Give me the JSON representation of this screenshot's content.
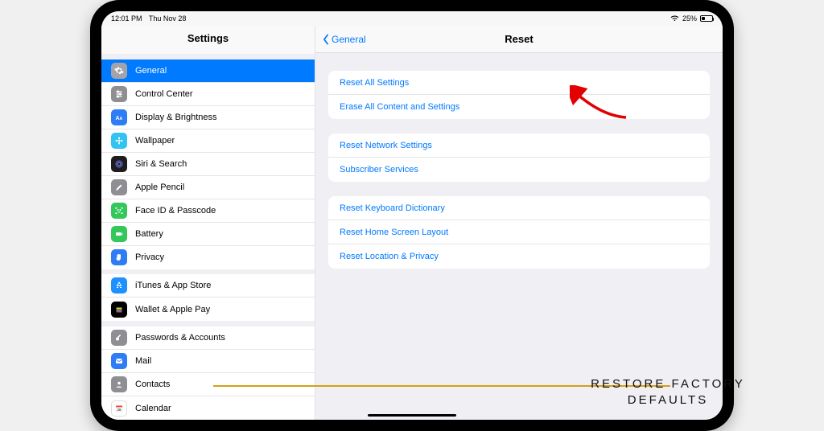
{
  "status": {
    "time": "12:01 PM",
    "date": "Thu Nov 28",
    "battery_pct": "25%"
  },
  "sidebar": {
    "title": "Settings",
    "items": [
      {
        "label": "General",
        "icon": "gear",
        "color": "#8e8e93",
        "selected": true
      },
      {
        "label": "Control Center",
        "icon": "sliders",
        "color": "#8e8e93",
        "selected": false
      },
      {
        "label": "Display & Brightness",
        "icon": "textsize",
        "color": "#2f7df6",
        "selected": false
      },
      {
        "label": "Wallpaper",
        "icon": "flower",
        "color": "#33c3f0",
        "selected": false
      },
      {
        "label": "Siri & Search",
        "icon": "siri",
        "color": "#1d1d1f",
        "selected": false
      },
      {
        "label": "Apple Pencil",
        "icon": "pencil",
        "color": "#8e8e93",
        "selected": false
      },
      {
        "label": "Face ID & Passcode",
        "icon": "faceid",
        "color": "#34c759",
        "selected": false
      },
      {
        "label": "Battery",
        "icon": "battery",
        "color": "#34c759",
        "selected": false
      },
      {
        "label": "Privacy",
        "icon": "hand",
        "color": "#2f7df6",
        "selected": false
      }
    ],
    "group2": [
      {
        "label": "iTunes & App Store",
        "icon": "appstore",
        "color": "#1e90ff"
      },
      {
        "label": "Wallet & Apple Pay",
        "icon": "wallet",
        "color": "#000000"
      }
    ],
    "group3": [
      {
        "label": "Passwords & Accounts",
        "icon": "key",
        "color": "#8e8e93"
      },
      {
        "label": "Mail",
        "icon": "mail",
        "color": "#2f7df6"
      },
      {
        "label": "Contacts",
        "icon": "contacts",
        "color": "#8e8e93"
      },
      {
        "label": "Calendar",
        "icon": "calendar",
        "color": "#ffffff"
      }
    ]
  },
  "detail": {
    "back_label": "General",
    "title": "Reset",
    "groups": [
      [
        {
          "label": "Reset All Settings"
        },
        {
          "label": "Erase All Content and Settings"
        }
      ],
      [
        {
          "label": "Reset Network Settings"
        },
        {
          "label": "Subscriber Services"
        }
      ],
      [
        {
          "label": "Reset Keyboard Dictionary"
        },
        {
          "label": "Reset Home Screen Layout"
        },
        {
          "label": "Reset Location & Privacy"
        }
      ]
    ]
  },
  "caption": {
    "line1": "RESTORE FACTORY",
    "line2": "DEFAULTS"
  },
  "colors": {
    "link": "#007aff",
    "underline": "#d4a017"
  }
}
